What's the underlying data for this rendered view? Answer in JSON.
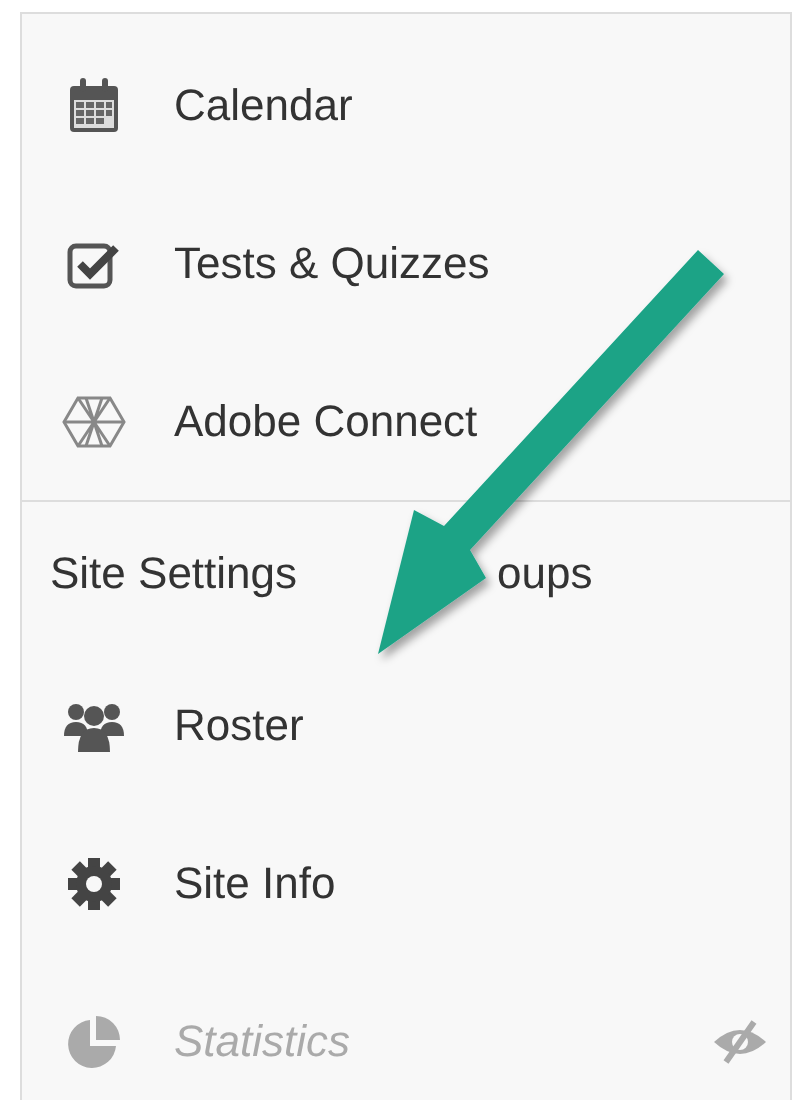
{
  "tools_group": {
    "items": [
      {
        "label": "Calendar",
        "hidden": false
      },
      {
        "label": "Tests & Quizzes",
        "hidden": false
      },
      {
        "label": "Adobe Connect",
        "hidden": false
      }
    ]
  },
  "settings_group": {
    "heading_parts": [
      "Site Settings",
      "oups"
    ],
    "items": [
      {
        "label": "Roster",
        "hidden": false
      },
      {
        "label": "Site Info",
        "hidden": false
      },
      {
        "label": "Statistics",
        "hidden": true
      }
    ]
  }
}
